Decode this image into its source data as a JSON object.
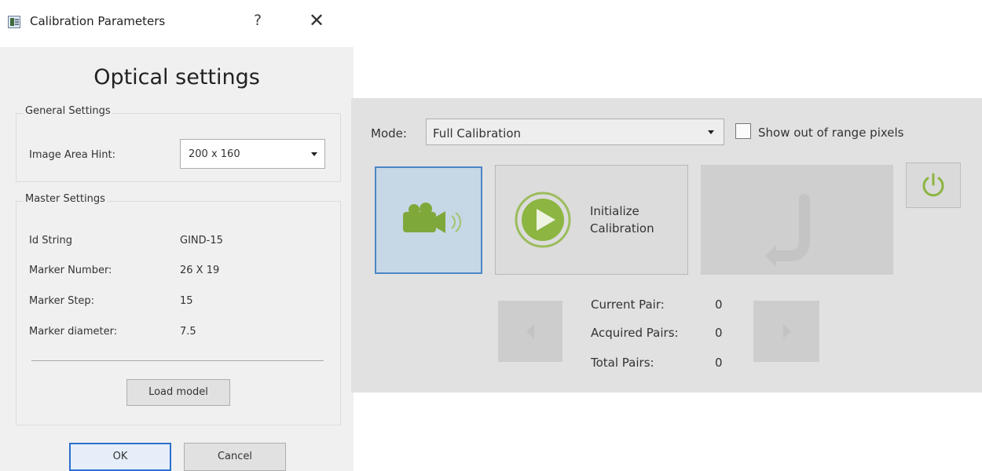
{
  "dialog": {
    "title": "Calibration Parameters",
    "help_glyph": "?",
    "close_glyph": "✕",
    "heading": "Optical settings",
    "general": {
      "title": "General Settings",
      "image_area_label": "Image Area Hint:",
      "image_area_value": "200 x 160"
    },
    "master": {
      "title": "Master Settings",
      "rows": [
        {
          "label": "Id String",
          "value": "GIND-15"
        },
        {
          "label": "Marker Number:",
          "value": "26 X 19"
        },
        {
          "label": "Marker Step:",
          "value": "15"
        },
        {
          "label": "Marker diameter:",
          "value": "7.5"
        }
      ],
      "load_model_label": "Load model"
    },
    "ok_label": "OK",
    "cancel_label": "Cancel"
  },
  "panel": {
    "mode_label": "Mode:",
    "mode_value": "Full Calibration",
    "show_out_of_range_label": "Show out of range pixels",
    "show_out_of_range_checked": false,
    "initialize_label_line1": "Initialize",
    "initialize_label_line2": "Calibration",
    "current_pair_label": "Current Pair:",
    "current_pair_value": "0",
    "acquired_pairs_label": "Acquired Pairs:",
    "acquired_pairs_value": "0",
    "total_pairs_label": "Total Pairs:",
    "total_pairs_value": "0"
  },
  "icons": {
    "camera": "camera-icon",
    "play": "play-icon",
    "undo": "undo-arrow-icon",
    "power": "power-icon",
    "prev": "arrow-left-icon",
    "next": "arrow-right-icon"
  },
  "colors": {
    "accent_green": "#8cb542",
    "selection_blue": "#4c85c6",
    "selection_fill": "#c6d7e6",
    "panel_bg": "#e1e1e1",
    "dialog_bg": "#f0f0f0"
  }
}
